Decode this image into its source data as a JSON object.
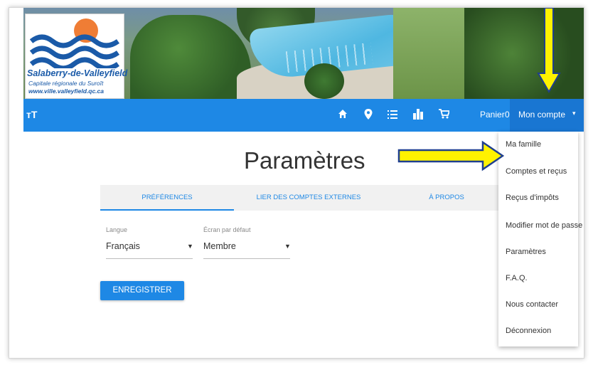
{
  "logo": {
    "name": "Salaberry-de-Valleyfield",
    "subtitle": "Capitale régionale du Suroît",
    "url": "www.ville.valleyfield.qc.ca"
  },
  "navbar": {
    "left_icon": "text-size-icon",
    "icons": [
      "home-icon",
      "map-pin-icon",
      "list-icon",
      "city-icon",
      "cart-icon"
    ],
    "cart_label": "Panier",
    "cart_count": "0",
    "account_label": "Mon compte",
    "account_caret": "▾"
  },
  "page": {
    "title": "Paramètres"
  },
  "tabs": [
    {
      "label": "PRÉFÉRENCES"
    },
    {
      "label": "LIER DES COMPTES EXTERNES"
    },
    {
      "label": "À PROPOS"
    }
  ],
  "form": {
    "language": {
      "label": "Langue",
      "value": "Français"
    },
    "default_screen": {
      "label": "Écran par défaut",
      "value": "Membre"
    },
    "save_label": "ENREGISTRER"
  },
  "account_menu": {
    "items": [
      {
        "label": "Ma famille"
      },
      {
        "label": "Comptes et reçus"
      },
      {
        "label": "Reçus d'impôts"
      },
      {
        "label": "Modifier mot de passe"
      },
      {
        "label": "Paramètres"
      },
      {
        "label": "F.A.Q."
      },
      {
        "label": "Nous contacter"
      },
      {
        "label": "Déconnexion"
      }
    ]
  },
  "colors": {
    "primary": "#1e88e5",
    "account_bg": "#1976d2",
    "annotation_arrow": "#fff200",
    "arrow_outline": "#1f3f8f"
  }
}
